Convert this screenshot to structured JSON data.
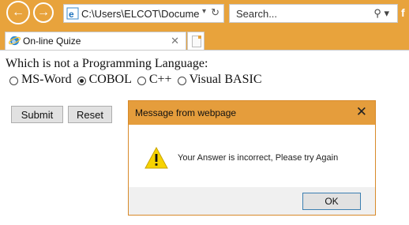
{
  "browser": {
    "address": "C:\\Users\\ELCOT\\Docume",
    "search_placeholder": "Search...",
    "tab_title": "On-line Quize"
  },
  "quiz": {
    "question": "Which is not a Programming Language:",
    "options": [
      {
        "label": "MS-Word",
        "selected": false
      },
      {
        "label": "COBOL",
        "selected": true
      },
      {
        "label": "C++",
        "selected": false
      },
      {
        "label": "Visual BASIC",
        "selected": false
      }
    ],
    "submit_label": "Submit",
    "reset_label": "Reset"
  },
  "dialog": {
    "title": "Message from webpage",
    "message": "Your Answer is incorrect, Please try Again",
    "ok_label": "OK",
    "icon": "warning-icon"
  },
  "colors": {
    "chrome": "#e8a33c",
    "dialog_title": "#e59d3c"
  }
}
